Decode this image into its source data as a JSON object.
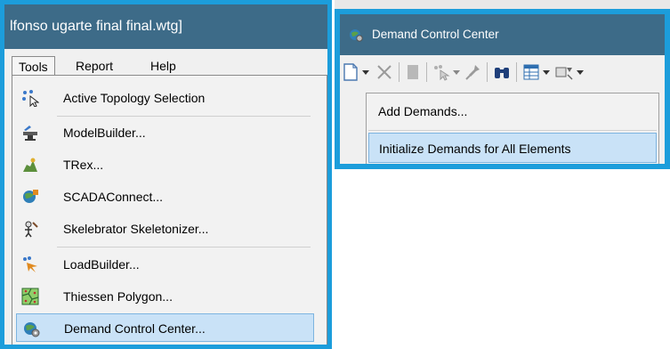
{
  "left_window": {
    "title": "lfonso ugarte final final.wtg]",
    "menubar": [
      {
        "label": "Tools"
      },
      {
        "label": "Report"
      },
      {
        "label": "Help"
      }
    ],
    "tools_menu": [
      {
        "label": "Active Topology Selection",
        "icon": "active-topology-icon"
      },
      {
        "label": "ModelBuilder...",
        "icon": "modelbuilder-icon"
      },
      {
        "label": "TRex...",
        "icon": "trex-icon"
      },
      {
        "label": "SCADAConnect...",
        "icon": "scadaconnect-icon"
      },
      {
        "label": "Skelebrator Skeletonizer...",
        "icon": "skelebrator-icon"
      },
      {
        "label": "LoadBuilder...",
        "icon": "loadbuilder-icon"
      },
      {
        "label": "Thiessen Polygon...",
        "icon": "thiessen-polygon-icon"
      },
      {
        "label": "Demand Control Center...",
        "icon": "demand-control-center-icon",
        "highlighted": true
      }
    ]
  },
  "right_window": {
    "title": "Demand Control Center",
    "dropdown": [
      {
        "label": "Add Demands..."
      },
      {
        "label": "Initialize Demands for All Elements",
        "highlighted": true
      }
    ]
  },
  "colors": {
    "frame_accent": "#1c9ddb",
    "title_bar": "#3d6b88",
    "highlight_bg": "#c9e2f7",
    "highlight_border": "#7db4e0"
  }
}
